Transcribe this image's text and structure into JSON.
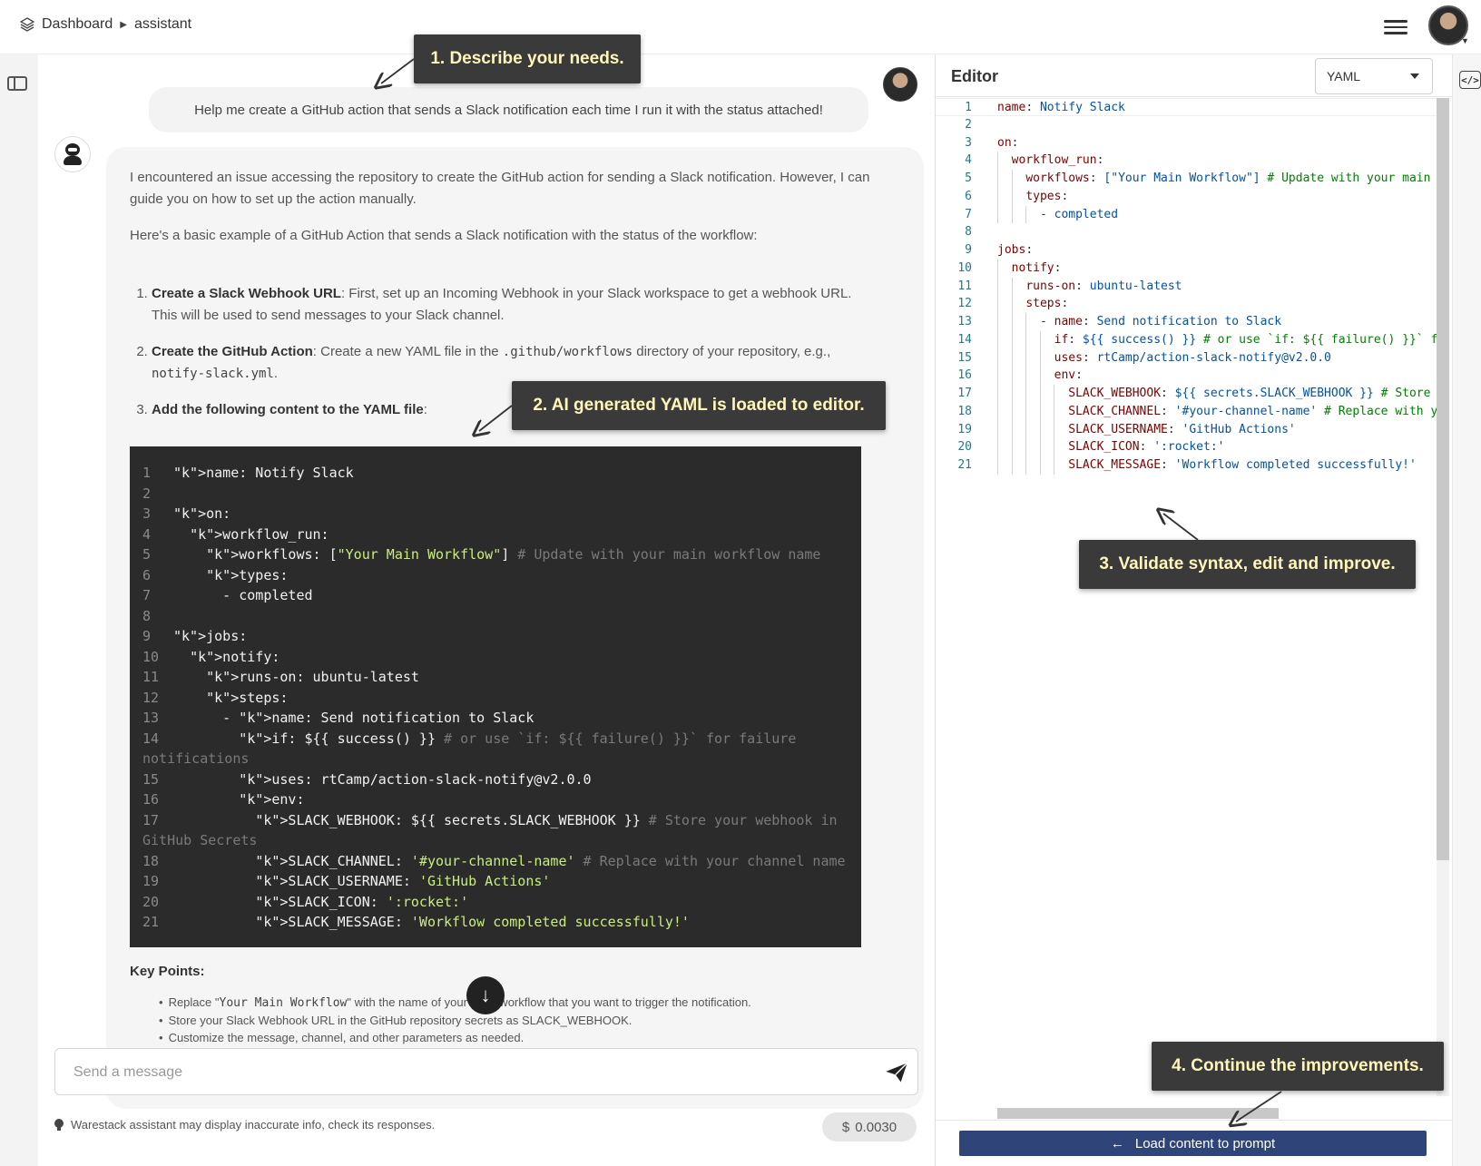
{
  "header": {
    "breadcrumb_home": "Dashboard",
    "breadcrumb_current": "assistant"
  },
  "chat": {
    "user_message": "Help me create a GitHub action that sends a Slack notification each time I run it with the status attached!",
    "bot_intro_1": "I encountered an issue accessing the repository to create the GitHub action for sending a Slack notification. However, I can guide you on how to set up the action manually.",
    "bot_intro_2": "Here's a basic example of a GitHub Action that sends a Slack notification with the status of the workflow:",
    "steps": [
      {
        "title": "Create a Slack Webhook URL",
        "text": ": First, set up an Incoming Webhook in your Slack workspace to get a webhook URL. This will be used to send messages to your Slack channel."
      },
      {
        "title": "Create the GitHub Action",
        "text_a": ": Create a new YAML file in the ",
        "code_a": ".github/workflows",
        "text_b": " directory of your repository, e.g., ",
        "code_b": "notify-slack.yml",
        "text_c": "."
      },
      {
        "title": "Add the following content to the YAML file",
        "text": ":"
      }
    ],
    "code_lines": [
      {
        "n": "1",
        "t": "name: Notify Slack"
      },
      {
        "n": "2",
        "t": ""
      },
      {
        "n": "3",
        "t": "on:"
      },
      {
        "n": "4",
        "t": "  workflow_run:"
      },
      {
        "n": "5",
        "t": "    workflows: [\"Your Main Workflow\"] # Update with your main workflow name"
      },
      {
        "n": "6",
        "t": "    types:"
      },
      {
        "n": "7",
        "t": "      - completed"
      },
      {
        "n": "8",
        "t": ""
      },
      {
        "n": "9",
        "t": "jobs:"
      },
      {
        "n": "10",
        "t": "  notify:"
      },
      {
        "n": "11",
        "t": "    runs-on: ubuntu-latest"
      },
      {
        "n": "12",
        "t": "    steps:"
      },
      {
        "n": "13",
        "t": "      - name: Send notification to Slack"
      },
      {
        "n": "14",
        "t": "        if: ${{ success() }} # or use `if: ${{ failure() }}` for failure"
      },
      {
        "n": "",
        "t": "notifications"
      },
      {
        "n": "15",
        "t": "        uses: rtCamp/action-slack-notify@v2.0.0"
      },
      {
        "n": "16",
        "t": "        env:"
      },
      {
        "n": "17",
        "t": "          SLACK_WEBHOOK: ${{ secrets.SLACK_WEBHOOK }} # Store your webhook in"
      },
      {
        "n": "",
        "t": "GitHub Secrets"
      },
      {
        "n": "18",
        "t": "          SLACK_CHANNEL: '#your-channel-name' # Replace with your channel name"
      },
      {
        "n": "19",
        "t": "          SLACK_USERNAME: 'GitHub Actions'"
      },
      {
        "n": "20",
        "t": "          SLACK_ICON: ':rocket:'"
      },
      {
        "n": "21",
        "t": "          SLACK_MESSAGE: 'Workflow completed successfully!'"
      }
    ],
    "key_points_title": "Key Points:",
    "key_points": [
      {
        "a": "Replace \"",
        "code": "Your Main Workflow",
        "b": "\" with the name of your main workflow that you want to trigger the notification."
      },
      {
        "a": "Store your Slack Webhook URL in the GitHub repository secrets as SLACK_WEBHOOK.",
        "code": "",
        "b": ""
      },
      {
        "a": "Customize the message, channel, and other parameters as needed.",
        "code": "",
        "b": ""
      }
    ],
    "composer_placeholder": "Send a message",
    "disclaimer": "Warestack assistant may display inaccurate info, check its responses.",
    "cost_symbol": "$",
    "cost_value": "0.0030"
  },
  "editor": {
    "title": "Editor",
    "language": "YAML",
    "lines": [
      "name: Notify Slack",
      "",
      "on:",
      "  workflow_run:",
      "    workflows: [\"Your Main Workflow\"] # Update with your main w",
      "    types:",
      "      - completed",
      "",
      "jobs:",
      "  notify:",
      "    runs-on: ubuntu-latest",
      "    steps:",
      "      - name: Send notification to Slack",
      "        if: ${{ success() }} # or use `if: ${{ failure() }}` fo",
      "        uses: rtCamp/action-slack-notify@v2.0.0",
      "        env:",
      "          SLACK_WEBHOOK: ${{ secrets.SLACK_WEBHOOK }} # Store y",
      "          SLACK_CHANNEL: '#your-channel-name' # Replace with yo",
      "          SLACK_USERNAME: 'GitHub Actions'",
      "          SLACK_ICON: ':rocket:'",
      "          SLACK_MESSAGE: 'Workflow completed successfully!'"
    ],
    "load_button": "Load content to prompt",
    "load_arrow": "←"
  },
  "callouts": {
    "c1": "1. Describe your needs.",
    "c2": "2. AI generated YAML is loaded to editor.",
    "c3": "3. Validate syntax, edit and improve.",
    "c4": "4. Continue the improvements."
  },
  "icons": {
    "breadcrumb_icon": "layers-icon",
    "menu": "hamburger-icon",
    "sidebar_toggle": "sidebar-panel-icon",
    "send": "paper-plane-icon",
    "scroll_down": "arrow-down-icon",
    "code_toggle": "code-brackets-icon",
    "disclaimer": "lightbulb-icon"
  },
  "colors": {
    "code_bg": "#2b2b2b",
    "callout_bg": "#3a3a3a",
    "callout_text": "#fff6b8",
    "load_button_bg": "#2f4479"
  }
}
